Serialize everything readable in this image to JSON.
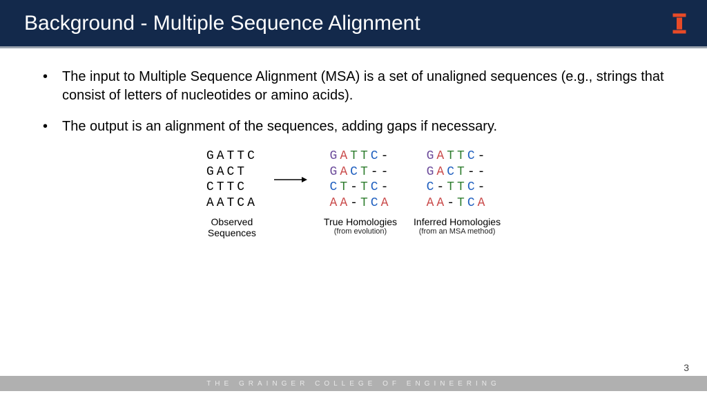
{
  "header": {
    "title": "Background - Multiple Sequence Alignment"
  },
  "bullets": [
    "The input to Multiple Sequence Alignment (MSA) is a set of unaligned sequences (e.g., strings that consist of letters of nucleotides or amino acids).",
    "The output is an alignment of the sequences, adding gaps if necessary."
  ],
  "sequences": {
    "observed": [
      "GATTC",
      "GACT",
      "CTTC",
      "AATCA"
    ],
    "true_homologies": [
      "GATTC-",
      "GACT--",
      "CT-TC-",
      "AA-TCA"
    ],
    "inferred_homologies": [
      "GATTC-",
      "GACT--",
      "C-TTC-",
      "AA-TCA"
    ]
  },
  "captions": {
    "observed": {
      "main": "Observed",
      "line2": "Sequences"
    },
    "true": {
      "main": "True Homologies",
      "sub": "(from evolution)"
    },
    "inferred": {
      "main": "Inferred Homologies",
      "sub": "(from an MSA method)"
    }
  },
  "footer": {
    "text": "THE GRAINGER COLLEGE OF ENGINEERING",
    "page": "3"
  },
  "colors": {
    "G": "#6b4a9a",
    "A": "#c94a4a",
    "T": "#2f7d2f",
    "C": "#1f5fbf",
    "-": "#000000"
  }
}
